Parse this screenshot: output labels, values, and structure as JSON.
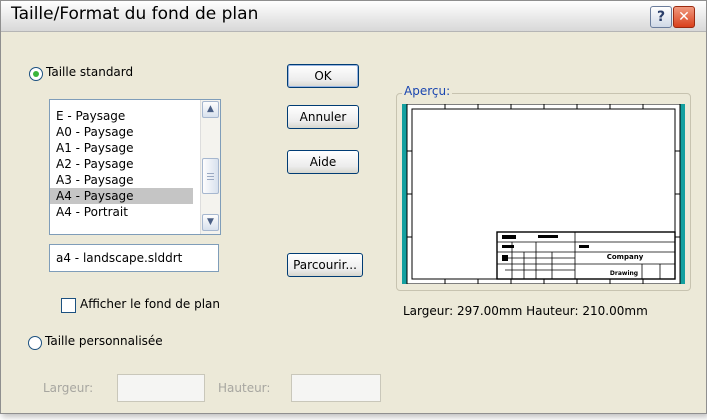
{
  "window": {
    "title": "Taille/Format du fond de plan",
    "help_glyph": "?",
    "close_glyph": "✕"
  },
  "standard": {
    "radio_label": "Taille standard",
    "selected": true,
    "list_items": [
      "E - Paysage",
      "A0 - Paysage",
      "A1 - Paysage",
      "A2 - Paysage",
      "A3 - Paysage",
      "A4 - Paysage",
      "A4 - Portrait"
    ],
    "selected_item": "A4 - Paysage",
    "file_value": "a4 - landscape.slddrt",
    "show_background_label": "Afficher le fond de plan",
    "show_background_checked": false
  },
  "custom": {
    "radio_label": "Taille personnalisée",
    "selected": false,
    "width_label": "Largeur:",
    "height_label": "Hauteur:"
  },
  "buttons": {
    "ok": "OK",
    "cancel": "Annuler",
    "help": "Aide",
    "browse": "Parcourir..."
  },
  "preview": {
    "group_title": "Aperçu:",
    "dimensions": "Largeur: 297.00mm Hauteur: 210.00mm",
    "accent_color": "#14a0a0",
    "title_block_label": "Drawing",
    "title_block_company": "Company"
  }
}
